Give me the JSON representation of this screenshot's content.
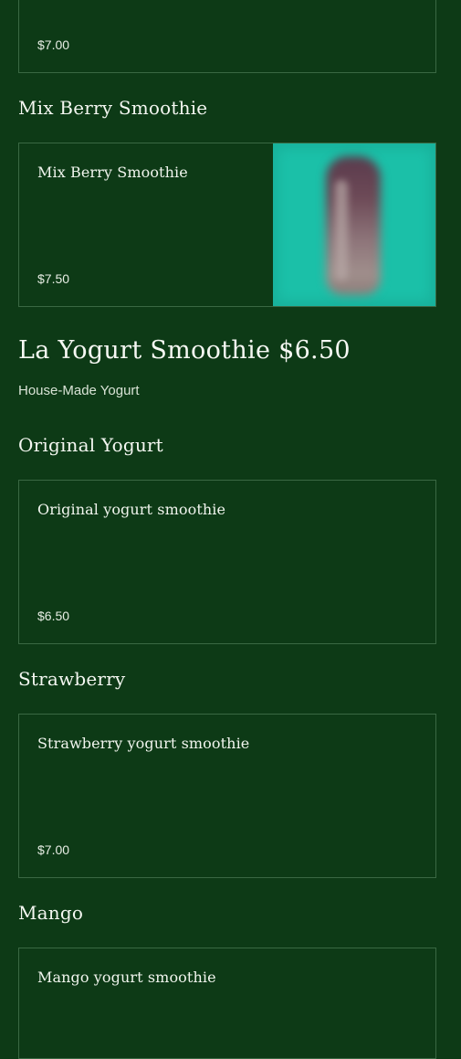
{
  "items_top": {
    "price": "$7.00"
  },
  "mix_berry": {
    "section_title": "Mix Berry Smoothie",
    "item_name": "Mix Berry Smoothie",
    "price": "$7.50",
    "image_icon": "smoothie-photo"
  },
  "yogurt_category": {
    "title": "La Yogurt Smoothie $6.50",
    "subtitle": "House-Made Yogurt"
  },
  "original": {
    "section_title": "Original Yogurt",
    "item_name": "Original yogurt smoothie",
    "price": "$6.50"
  },
  "strawberry": {
    "section_title": "Strawberry",
    "item_name": "Strawberry yogurt smoothie",
    "price": "$7.00"
  },
  "mango": {
    "section_title": "Mango",
    "item_name": "Mango yogurt smoothie"
  },
  "colors": {
    "background": "#0d3a16",
    "card_border": "#3a6843",
    "image_bg": "#18b29c"
  }
}
